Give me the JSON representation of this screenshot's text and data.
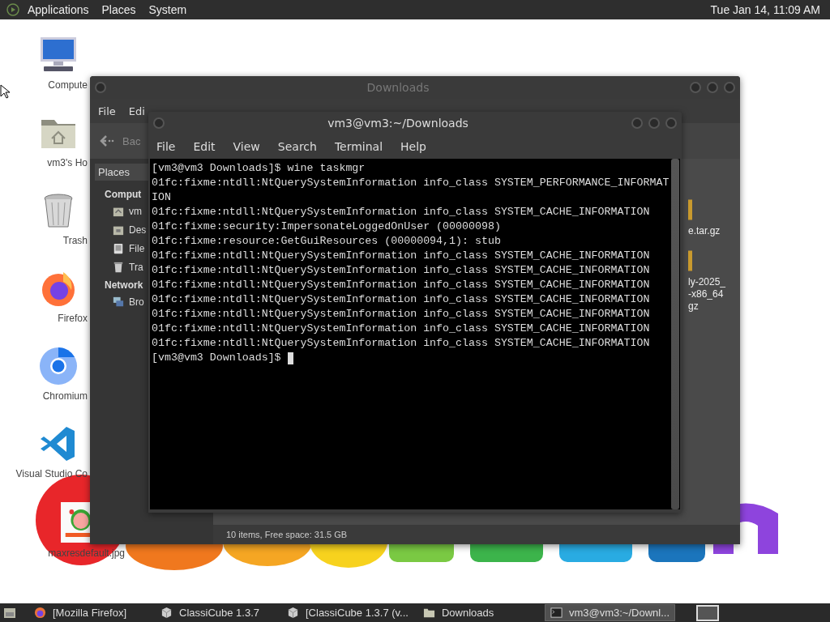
{
  "top_panel": {
    "menus": [
      "Applications",
      "Places",
      "System"
    ],
    "clock": "Tue Jan 14, 11:09 AM"
  },
  "desktop_icons": [
    {
      "kind": "computer",
      "label": "Compute"
    },
    {
      "kind": "home",
      "label": "vm3's Ho"
    },
    {
      "kind": "trash",
      "label": "Trash"
    },
    {
      "kind": "firefox",
      "label": "Firefox"
    },
    {
      "kind": "chromium",
      "label": "Chromium"
    },
    {
      "kind": "vscode",
      "label": "Visual Studio Co"
    },
    {
      "kind": "picture",
      "label": "maxresdefault.jpg"
    }
  ],
  "file_manager": {
    "title": "Downloads",
    "menu": [
      "File",
      "Edi"
    ],
    "back_label": "Bac",
    "sidebar": {
      "header": "Places",
      "sections": [
        {
          "title": "Comput",
          "items": [
            {
              "kind": "home",
              "label": "vm"
            },
            {
              "kind": "desktop",
              "label": "Des"
            },
            {
              "kind": "drive",
              "label": "File"
            },
            {
              "kind": "trash",
              "label": "Tra"
            }
          ]
        },
        {
          "title": "Network",
          "items": [
            {
              "kind": "network",
              "label": "Bro"
            }
          ]
        }
      ]
    },
    "files": [
      {
        "lines": [
          "e.tar.gz"
        ]
      },
      {
        "lines": [
          "ly-2025_",
          "-x86_64",
          "gz"
        ]
      }
    ],
    "status": "10 items, Free space: 31.5 GB"
  },
  "terminal": {
    "title": "vm3@vm3:~/Downloads",
    "menu": [
      "File",
      "Edit",
      "View",
      "Search",
      "Terminal",
      "Help"
    ],
    "lines": [
      "[vm3@vm3 Downloads]$ wine taskmgr",
      "01fc:fixme:ntdll:NtQuerySystemInformation info_class SYSTEM_PERFORMANCE_INFORMAT",
      "ION",
      "01fc:fixme:ntdll:NtQuerySystemInformation info_class SYSTEM_CACHE_INFORMATION",
      "01fc:fixme:security:ImpersonateLoggedOnUser (00000098)",
      "01fc:fixme:resource:GetGuiResources (00000094,1): stub",
      "01fc:fixme:ntdll:NtQuerySystemInformation info_class SYSTEM_CACHE_INFORMATION",
      "01fc:fixme:ntdll:NtQuerySystemInformation info_class SYSTEM_CACHE_INFORMATION",
      "01fc:fixme:ntdll:NtQuerySystemInformation info_class SYSTEM_CACHE_INFORMATION",
      "01fc:fixme:ntdll:NtQuerySystemInformation info_class SYSTEM_CACHE_INFORMATION",
      "01fc:fixme:ntdll:NtQuerySystemInformation info_class SYSTEM_CACHE_INFORMATION",
      "01fc:fixme:ntdll:NtQuerySystemInformation info_class SYSTEM_CACHE_INFORMATION",
      "01fc:fixme:ntdll:NtQuerySystemInformation info_class SYSTEM_CACHE_INFORMATION"
    ],
    "prompt": "[vm3@vm3 Downloads]$"
  },
  "taskbar": {
    "tasks": [
      {
        "kind": "firefox",
        "label": "[Mozilla Firefox]",
        "selected": false
      },
      {
        "kind": "cube",
        "label": "ClassiCube 1.3.7",
        "selected": false
      },
      {
        "kind": "cube",
        "label": "[ClassiCube 1.3.7 (v...",
        "selected": false
      },
      {
        "kind": "folder",
        "label": "Downloads",
        "selected": false
      },
      {
        "kind": "terminal",
        "label": "vm3@vm3:~/Downl...",
        "selected": true
      }
    ]
  }
}
